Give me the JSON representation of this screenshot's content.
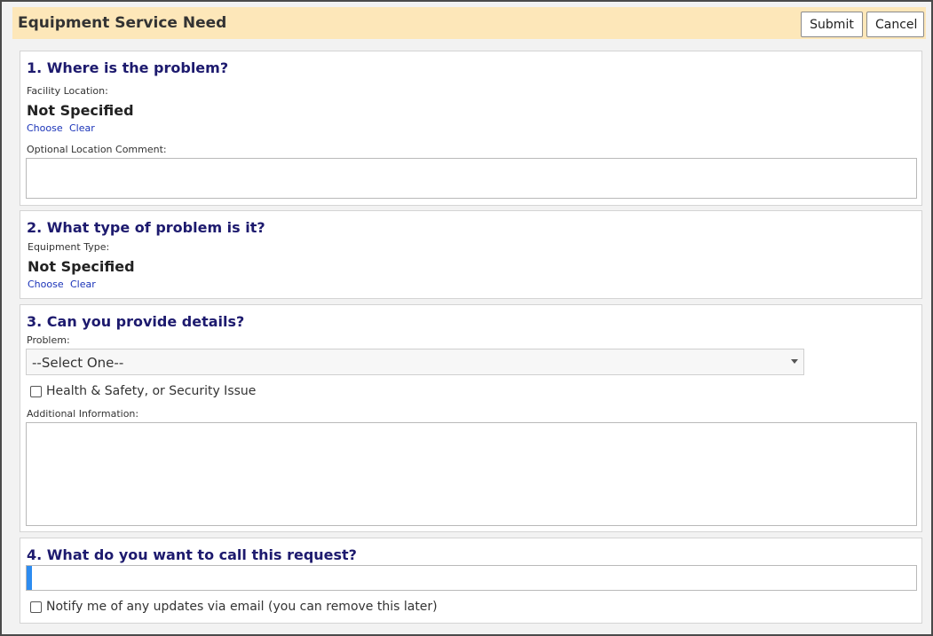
{
  "header": {
    "title": "Equipment Service Need",
    "submit_label": "Submit",
    "cancel_label": "Cancel"
  },
  "section1": {
    "heading": "1. Where is the problem?",
    "facility_label": "Facility Location:",
    "facility_value": "Not Specified",
    "choose_label": "Choose",
    "clear_label": "Clear",
    "comment_label": "Optional Location Comment:",
    "comment_value": ""
  },
  "section2": {
    "heading": "2. What type of problem is it?",
    "equipment_label": "Equipment Type:",
    "equipment_value": "Not Specified",
    "choose_label": "Choose",
    "clear_label": "Clear"
  },
  "section3": {
    "heading": "3. Can you provide details?",
    "problem_label": "Problem:",
    "problem_selected": "--Select One--",
    "hs_checkbox_label": "Health & Safety, or Security Issue",
    "additional_label": "Additional Information:",
    "additional_value": ""
  },
  "section4": {
    "heading": "4. What do you want to call this request?",
    "request_name_value": "",
    "notify_label": "Notify me of any updates via email (you can remove this later)"
  },
  "colors": {
    "header_bg": "#fde7b9",
    "heading_color": "#1d1a6e",
    "link_color": "#1a33b8",
    "focus_accent": "#2d8cf0"
  }
}
